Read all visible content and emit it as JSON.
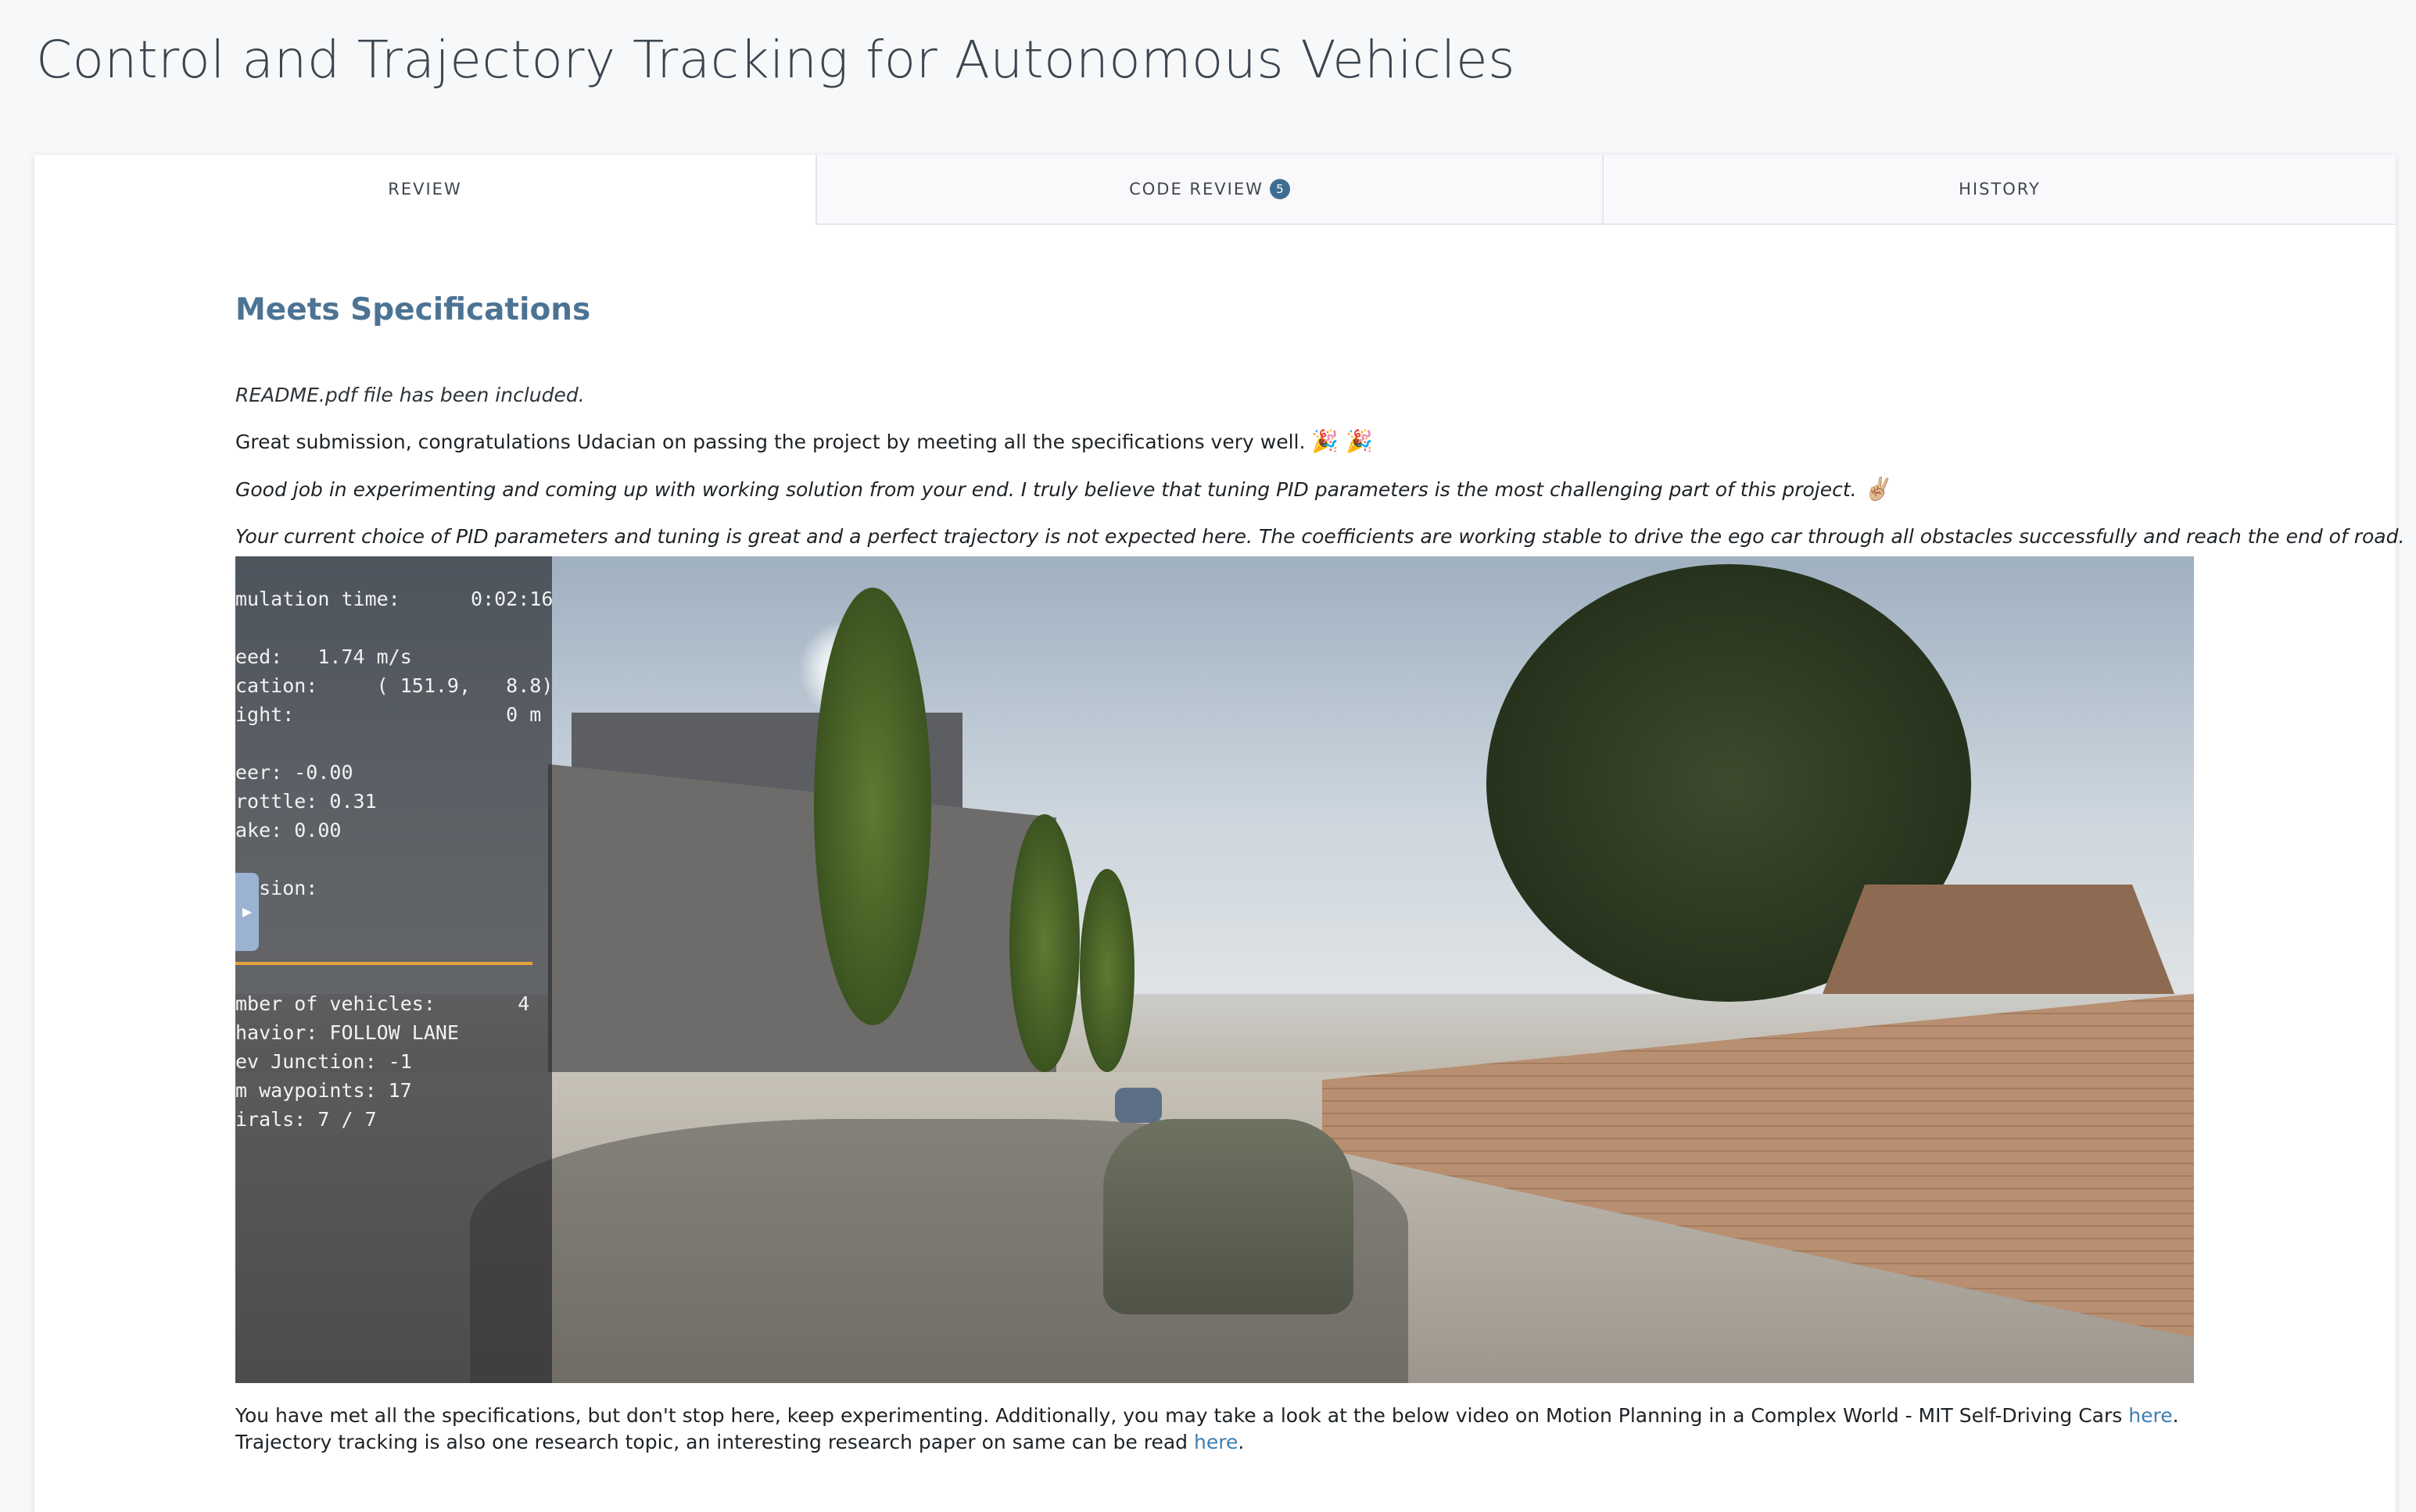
{
  "page": {
    "title": "Control and Trajectory Tracking for Autonomous Vehicles"
  },
  "tabs": [
    {
      "label": "REVIEW",
      "active": true
    },
    {
      "label": "CODE REVIEW",
      "badge": "5",
      "active": false
    },
    {
      "label": "HISTORY",
      "active": false
    }
  ],
  "review": {
    "heading": "Meets Specifications",
    "readme": "README.pdf file has been included.",
    "great": "Great submission, congratulations Udacian on passing the project by meeting all the specifications very well.",
    "great_emoji": "🎉 🎉",
    "goodjob": "Good job in experimenting and coming up with working solution from your end. I truly believe that tuning PID parameters is the most challenging part of this project.",
    "goodjob_emoji": "✌🏼",
    "current": "Your current choice of PID parameters and tuning is great and a perfect trajectory is not expected here. The coefficients are working stable to drive the ego car through all obstacles successfully and reach the end of road.",
    "bottom_part1": "You have met all the specifications, but don't stop here, keep experimenting. Additionally, you may take a look at the below video on Motion Planning in a Complex World - MIT Self-Driving Cars ",
    "link1": "here",
    "bottom_part2": ". Trajectory tracking is also one research topic, an interesting research paper on same can be read ",
    "link2": "here",
    "bottom_part3": "."
  },
  "simulation_hud": {
    "lines": [
      "mulation time:      0:02:16",
      "",
      "eed:   1.74 m/s",
      "cation:     ( 151.9,   8.8)",
      "ight:                  0 m",
      "",
      "eer: -0.00",
      "rottle: 0.31",
      "ake: 0.00",
      "",
      "lision:",
      "",
      "",
      "",
      "mber of vehicles:       4",
      "havior: FOLLOW LANE",
      "ev Junction: -1",
      "m waypoints: 17",
      "irals: 7 / 7"
    ]
  },
  "colors": {
    "heading": "#4c7394",
    "link": "#3d7fb3",
    "badge": "#3f6d8f",
    "hud_separator": "#e3a23b"
  }
}
